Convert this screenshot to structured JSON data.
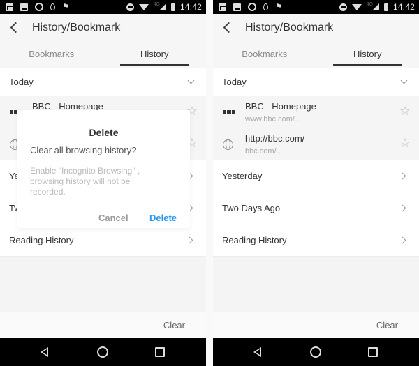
{
  "statusbar": {
    "time": "14:42",
    "network": "4G",
    "icons_left": [
      "gmail-icon",
      "gallery-icon",
      "whatsapp-icon",
      "location-icon",
      "flag-icon"
    ],
    "icons_right": [
      "do-not-disturb-icon",
      "wifi-icon",
      "signal-icon",
      "battery-icon"
    ]
  },
  "header": {
    "title": "History/Bookmark",
    "back_icon": "chevron-left-icon"
  },
  "tabs": [
    {
      "label": "Bookmarks",
      "active": false
    },
    {
      "label": "History",
      "active": true
    }
  ],
  "history": {
    "today_label": "Today",
    "items": [
      {
        "title": "BBC - Homepage",
        "url": "www.bbc.com/...",
        "icon": "bbc-favicon-icon"
      },
      {
        "title": "http://bbc.com/",
        "url": "bbc.com/...",
        "icon": "globe-icon"
      }
    ],
    "groups": [
      "Yesterday",
      "Two Days Ago",
      "Reading History"
    ]
  },
  "left_panel_partial": {
    "yesterday_fragment": "Ye",
    "two_days_fragment": "Tw"
  },
  "footer": {
    "clear_label": "Clear"
  },
  "dialog": {
    "title": "Delete",
    "message": "Clear all browsing history?",
    "note": "Enable \"Incognito Browsing\" , browsing history will not be recorded.",
    "cancel_label": "Cancel",
    "delete_label": "Delete",
    "accent_color": "#2196f3"
  },
  "navbar": {
    "buttons": [
      "back-icon",
      "home-icon",
      "recents-icon"
    ]
  }
}
